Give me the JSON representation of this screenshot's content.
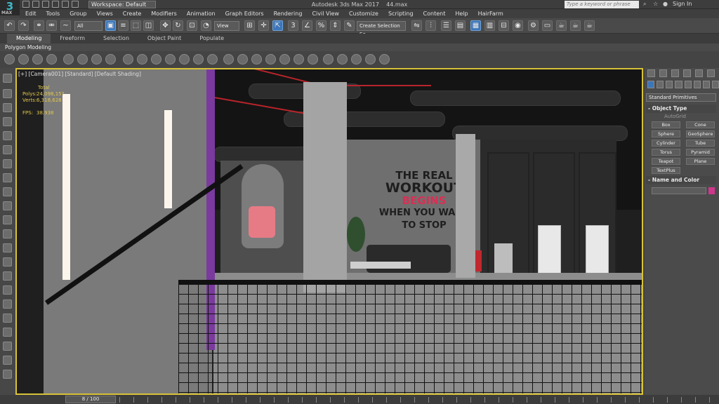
{
  "app": {
    "logo_text": "3",
    "logo_sub": "MAX",
    "title": "Autodesk 3ds Max 2017",
    "filename": "44.max",
    "workspace": "Workspace: Default",
    "search_placeholder": "Type a keyword or phrase",
    "sign_in": "Sign In"
  },
  "menu": [
    "Edit",
    "Tools",
    "Group",
    "Views",
    "Create",
    "Modifiers",
    "Animation",
    "Graph Editors",
    "Rendering",
    "Civil View",
    "Customize",
    "Scripting",
    "Content",
    "Help",
    "HairFarm"
  ],
  "toolbar": {
    "selection_filter": "All",
    "ref_coord": "View",
    "selection_set": "Create Selection Se",
    "angle_snap": "3",
    "percent_snap": "%"
  },
  "ribbon": {
    "tabs": [
      "Modeling",
      "Freeform",
      "Selection",
      "Object Paint",
      "Populate"
    ],
    "active_tab": "Modeling",
    "sub": "Polygon Modeling"
  },
  "viewport": {
    "label": "[+] [Camera001] [Standard] [Default Shading]",
    "stats_total": "Total",
    "stats": [
      {
        "k": "Polys:",
        "v": "24,098,15?"
      },
      {
        "k": "Verts:",
        "v": "6,318,628"
      },
      {
        "k": "FPS:",
        "v": "38.938"
      }
    ],
    "wall_text": [
      "THE REAL",
      "WORKOUT",
      "BEGINS",
      "WHEN YOU WANT",
      "TO STOP"
    ]
  },
  "command_panel": {
    "category": "Standard Primitives",
    "object_type": "Object Type",
    "autogrid": "AutoGrid",
    "objects": [
      "Box",
      "Cone",
      "Sphere",
      "GeoSphere",
      "Cylinder",
      "Tube",
      "Torus",
      "Pyramid",
      "Teapot",
      "Plane",
      "TextPlus"
    ],
    "name_and_color": "Name and Color",
    "object_color": "#d0368c"
  },
  "timeline": {
    "frame": "8 / 100"
  }
}
